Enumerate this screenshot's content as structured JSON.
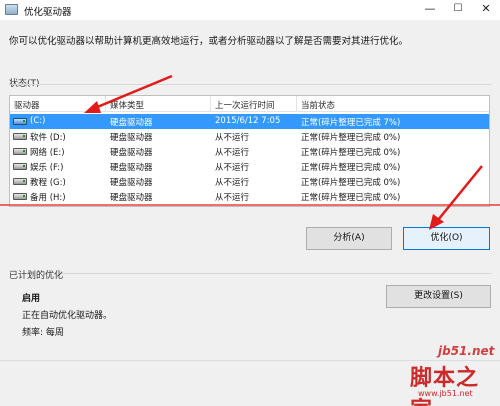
{
  "window": {
    "title": "优化驱动器",
    "min_glyph": "—",
    "max_glyph": "☐",
    "close_glyph": "✕",
    "app_icon": "drive-optimize-icon"
  },
  "intro_text": "你可以优化驱动器以帮助计算机更高效地运行，或者分析驱动器以了解是否需要对其进行优化。",
  "status_section": {
    "label": "状态(T)",
    "columns": [
      "驱动器",
      "媒体类型",
      "上一次运行时间",
      "当前状态"
    ],
    "drives": [
      {
        "name": "(C:)",
        "media": "硬盘驱动器",
        "last_run": "2015/6/12 7:05",
        "status": "正常(碎片整理已完成 7%)",
        "selected": true,
        "icon": "os-drive-icon"
      },
      {
        "name": "软件 (D:)",
        "media": "硬盘驱动器",
        "last_run": "从不运行",
        "status": "正常(碎片整理已完成 0%)",
        "selected": false,
        "icon": "hard-drive-icon"
      },
      {
        "name": "网络 (E:)",
        "media": "硬盘驱动器",
        "last_run": "从不运行",
        "status": "正常(碎片整理已完成 0%)",
        "selected": false,
        "icon": "hard-drive-icon"
      },
      {
        "name": "娱乐 (F:)",
        "media": "硬盘驱动器",
        "last_run": "从不运行",
        "status": "正常(碎片整理已完成 0%)",
        "selected": false,
        "icon": "hard-drive-icon"
      },
      {
        "name": "教程 (G:)",
        "media": "硬盘驱动器",
        "last_run": "从不运行",
        "status": "正常(碎片整理已完成 0%)",
        "selected": false,
        "icon": "hard-drive-icon"
      },
      {
        "name": "备用 (H:)",
        "media": "硬盘驱动器",
        "last_run": "从不运行",
        "status": "正常(碎片整理已完成 0%)",
        "selected": false,
        "icon": "hard-drive-icon"
      }
    ]
  },
  "actions": {
    "analyze_label": "分析(A)",
    "optimize_label": "优化(O)"
  },
  "schedule": {
    "label": "已计划的优化",
    "status": "启用",
    "description": "正在自动优化驱动器。",
    "frequency": "频率: 每周",
    "change_settings_label": "更改设置(S)"
  },
  "watermark": {
    "domain": "jb51.net",
    "logo": "脚本之家",
    "url": "www.jb51.net"
  },
  "colors": {
    "selection": "#3399ff",
    "annotation_red": "#e11b1b",
    "primary_border": "#0078d7"
  }
}
